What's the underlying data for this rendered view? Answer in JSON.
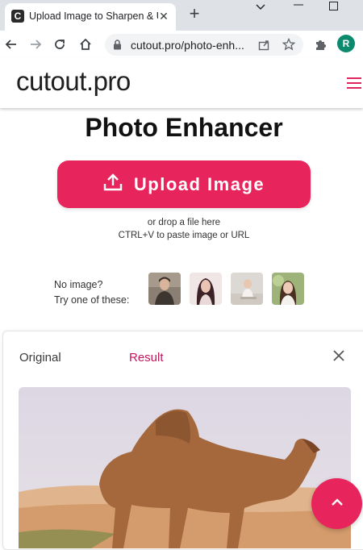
{
  "browser": {
    "tab_title": "Upload Image to Sharpen & U",
    "url": "cutout.pro/photo-enh...",
    "profile_initial": "R"
  },
  "site": {
    "logo": "cutout.pro"
  },
  "main": {
    "title": "Photo Enhancer",
    "upload_label": "Upload Image",
    "drop_line1": "or drop a file here",
    "drop_line2": "CTRL+V to paste image or URL",
    "sample_line1": "No image?",
    "sample_line2": "Try one of these:"
  },
  "compare": {
    "tab_original": "Original",
    "tab_result": "Result"
  },
  "colors": {
    "accent": "#e8245c",
    "result_tab": "#c2185b"
  },
  "icons": [
    "app-favicon",
    "close-icon",
    "plus-icon",
    "chevron-down-icon",
    "minimize-icon",
    "maximize-icon",
    "back-arrow-icon",
    "forward-arrow-icon",
    "reload-icon",
    "home-icon",
    "lock-icon",
    "share-icon",
    "star-icon",
    "extensions-icon",
    "hamburger-icon",
    "upload-icon",
    "chevron-up-icon"
  ]
}
